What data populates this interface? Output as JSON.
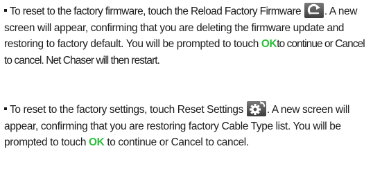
{
  "paragraphs": [
    {
      "text_before_icon": "To reset to the factory firmware, touch the Reload Factory Firmware",
      "icon": "reload-arrow-icon",
      "text_after_icon": ". A new screen will appear, confirming that you are deleting the firmware update and restoring to factory default. You will be prompted to touch",
      "ok_label": "OK",
      "text_after_ok": "to continue or Cancel to cancel. Net Chaser will then restart."
    },
    {
      "text_before_icon": "To reset to the factory settings, touch Reset Settings",
      "icon": "gear-reset-icon",
      "text_after_icon": ". A new screen will appear, confirming that you are restoring factory Cable Type list. You will be prompted to touch",
      "ok_label": "OK",
      "text_after_ok": "to continue or Cancel to cancel."
    }
  ],
  "colors": {
    "ok_text": "#2bbf3a",
    "icon_background": "#5a5a5a"
  }
}
